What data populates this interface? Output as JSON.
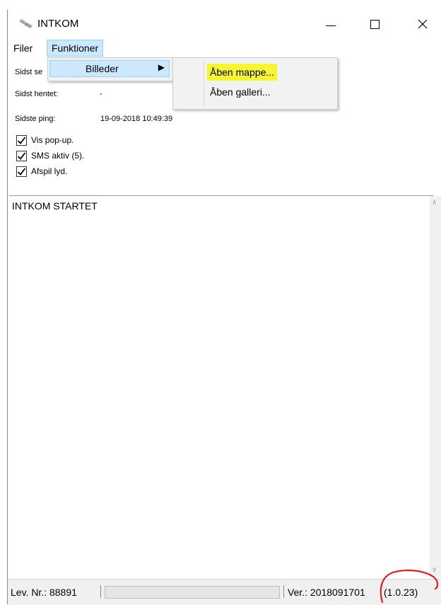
{
  "window": {
    "title": "INTKOM"
  },
  "menu": {
    "items": [
      "Filer",
      "Funktioner"
    ]
  },
  "info": {
    "sidst_sendt_label": "Sidst se",
    "sidst_hentet_label": "Sidst hentet:",
    "sidst_hentet_value": "-",
    "sidste_ping_label": "Sidste ping:",
    "sidste_ping_value": "19-09-2018 10:49:39"
  },
  "checkboxes": [
    {
      "label": "Vis pop-up.",
      "checked": true
    },
    {
      "label": "SMS aktiv (5).",
      "checked": true
    },
    {
      "label": "Afspil lyd.",
      "checked": true
    }
  ],
  "log": {
    "text": "INTKOM STARTET"
  },
  "status": {
    "lev_nr": "Lev. Nr.: 88891",
    "version": "Ver.: 2018091701",
    "build": "(1.0.23)"
  },
  "dropdown_funktioner": {
    "items": [
      "Billeder"
    ]
  },
  "dropdown_billeder": {
    "items": [
      "Åben mappe...",
      "Åben galleri..."
    ]
  },
  "colors": {
    "highlight": "#f5f532",
    "annotation": "#e0201a",
    "menu_active": "#cce8ff"
  }
}
